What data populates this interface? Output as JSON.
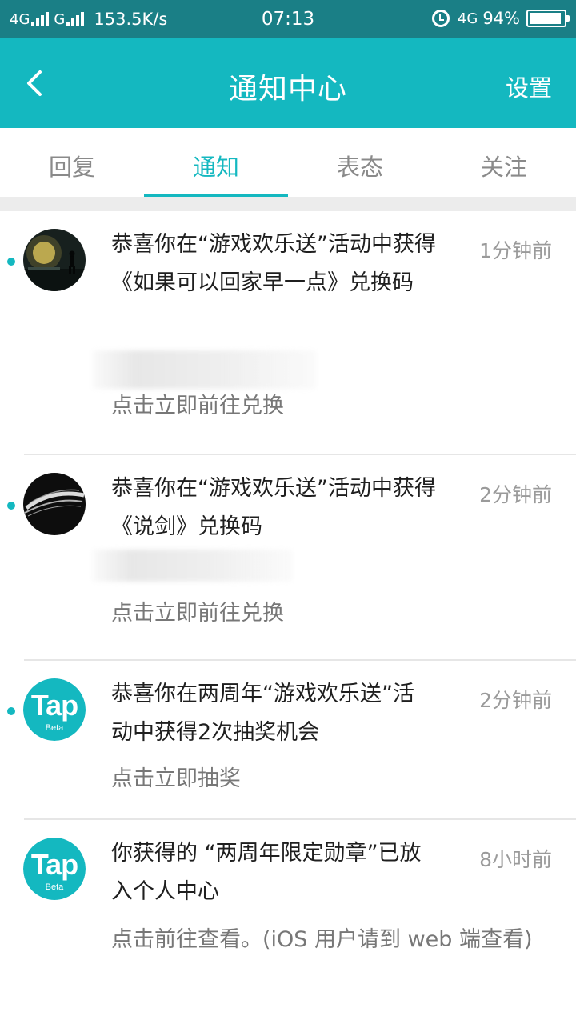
{
  "statusbar": {
    "net1": "4G",
    "net2": "G",
    "speed": "153.5K/s",
    "time": "07:13",
    "net3": "4G",
    "battery": "94%",
    "battery_level": 0.94
  },
  "header": {
    "back_icon": "chevron-left-icon",
    "title": "通知中心",
    "settings_label": "设置"
  },
  "tabs": [
    {
      "label": "回复",
      "active": false
    },
    {
      "label": "通知",
      "active": true
    },
    {
      "label": "表态",
      "active": false
    },
    {
      "label": "关注",
      "active": false
    }
  ],
  "notifications": [
    {
      "unread": true,
      "avatar": "night-scene-avatar",
      "text": "恭喜你在“游戏欢乐送”活动中获得《如果可以回家早一点》兑换码",
      "time": "1分钟前",
      "action": "点击立即前往兑换"
    },
    {
      "unread": true,
      "avatar": "brush-stroke-avatar",
      "text": "恭喜你在“游戏欢乐送”活动中获得《说剑》兑换码",
      "time": "2分钟前",
      "action": "点击立即前往兑换"
    },
    {
      "unread": true,
      "avatar": "tap-logo",
      "avatar_word": "Tap",
      "avatar_sub": "Beta",
      "text": "恭喜你在两周年“游戏欢乐送”活动中获得2次抽奖机会",
      "time": "2分钟前",
      "action": "点击立即抽奖"
    },
    {
      "unread": false,
      "avatar": "tap-logo",
      "avatar_word": "Tap",
      "avatar_sub": "Beta",
      "text": "你获得的 “两周年限定勋章”已放入个人中心",
      "time": "8小时前",
      "action": "点击前往查看。(iOS 用户请到 web 端查看)"
    }
  ],
  "colors": {
    "accent": "#14b8c0",
    "statusbar": "#1a7f86"
  }
}
